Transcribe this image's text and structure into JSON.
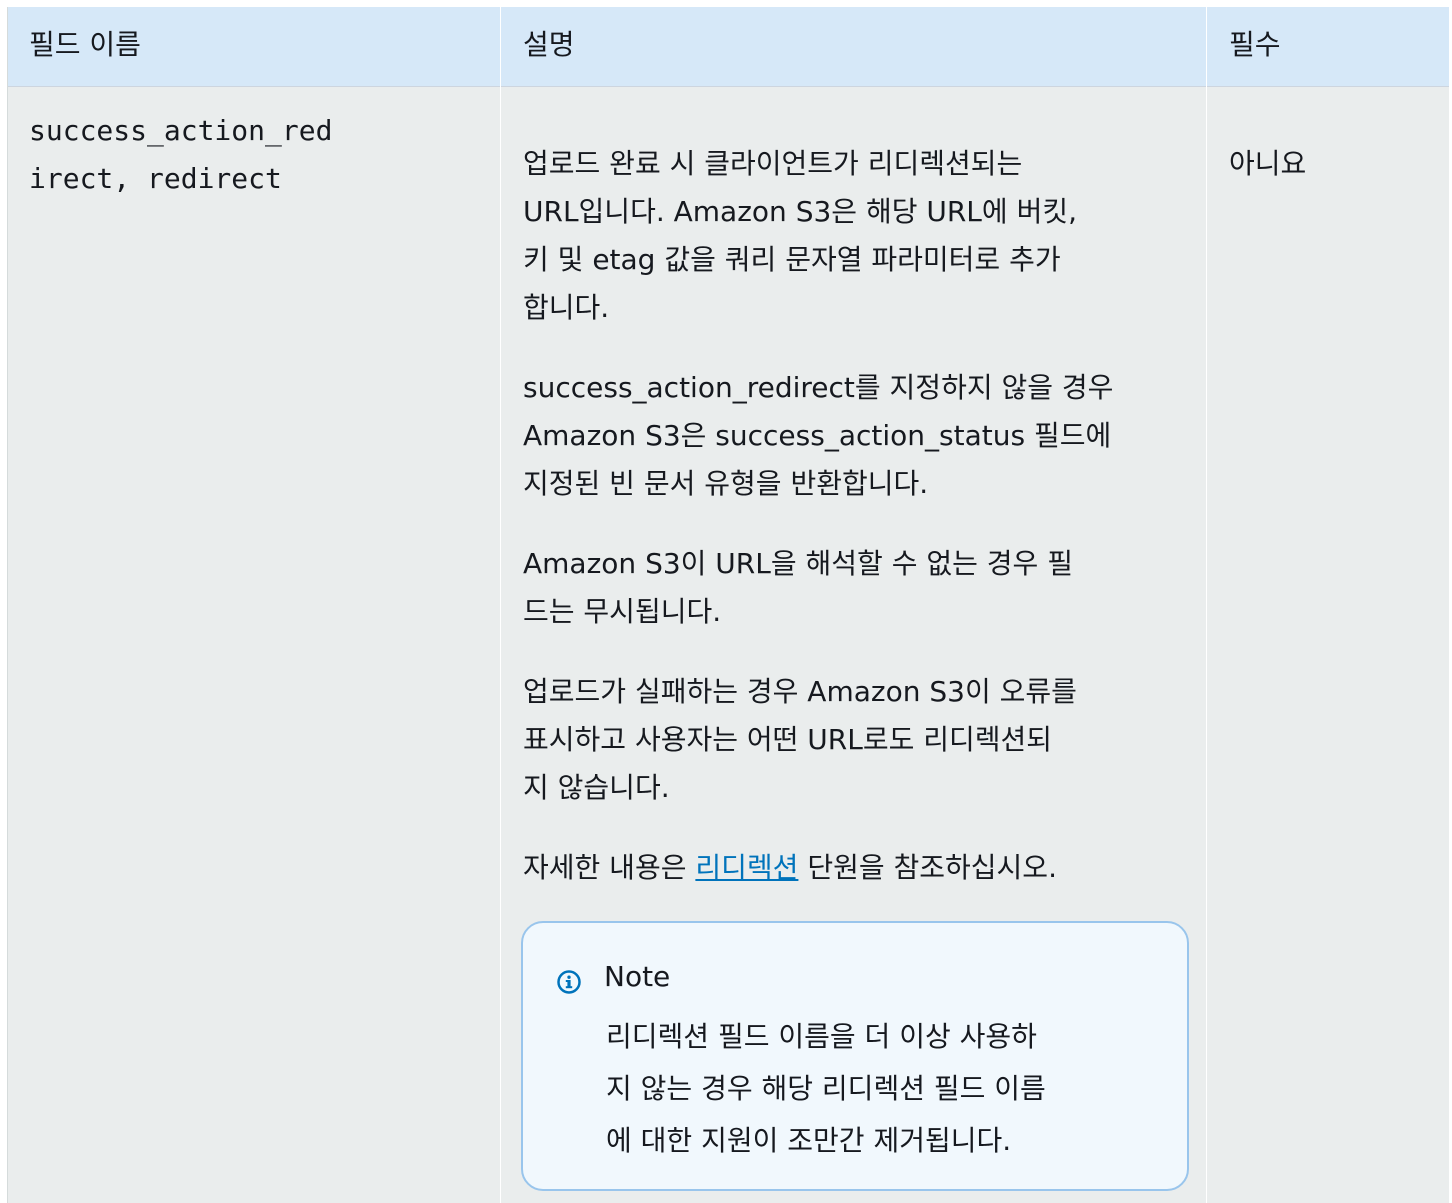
{
  "table": {
    "headers": {
      "field_name": "필드 이름",
      "description": "설명",
      "required": "필수"
    },
    "row": {
      "field_name_line1": "success_action_red",
      "field_name_line2": "irect, redirect",
      "required": "아니요",
      "description": {
        "p1": [
          "업로드 완료 시 클라이언트가 리디렉션되는",
          "URL입니다. Amazon S3은 해당 URL에 버킷,",
          "키 및 etag 값을 쿼리 문자열 파라미터로 추가",
          "합니다."
        ],
        "p2": [
          "success_action_redirect를 지정하지 않을 경우",
          "Amazon S3은 success_action_status 필드에",
          "지정된 빈 문서 유형을 반환합니다."
        ],
        "p3": [
          "Amazon S3이 URL을 해석할 수 없는 경우 필",
          "드는 무시됩니다."
        ],
        "p4": [
          "업로드가 실패하는 경우 Amazon S3이 오류를",
          "표시하고 사용자는 어떤 URL로도 리디렉션되",
          "지 않습니다."
        ],
        "p5_before": "자세한 내용은 ",
        "p5_link": "리디렉션",
        "p5_after": " 단원을 참조하십시오."
      },
      "note": {
        "icon": "info-icon",
        "title": "Note",
        "lines": [
          "리디렉션 필드 이름을 더 이상 사용하",
          "지 않는 경우 해당 리디렉션 필드 이름",
          "에 대한 지원이 조만간 제거됩니다."
        ]
      }
    }
  },
  "colors": {
    "header_bg": "#d6e8f8",
    "row_bg": "#eaeded",
    "link": "#0073bb",
    "note_bg": "#f1f8fd",
    "note_border": "#99c5ec",
    "info_icon": "#0073bb"
  }
}
